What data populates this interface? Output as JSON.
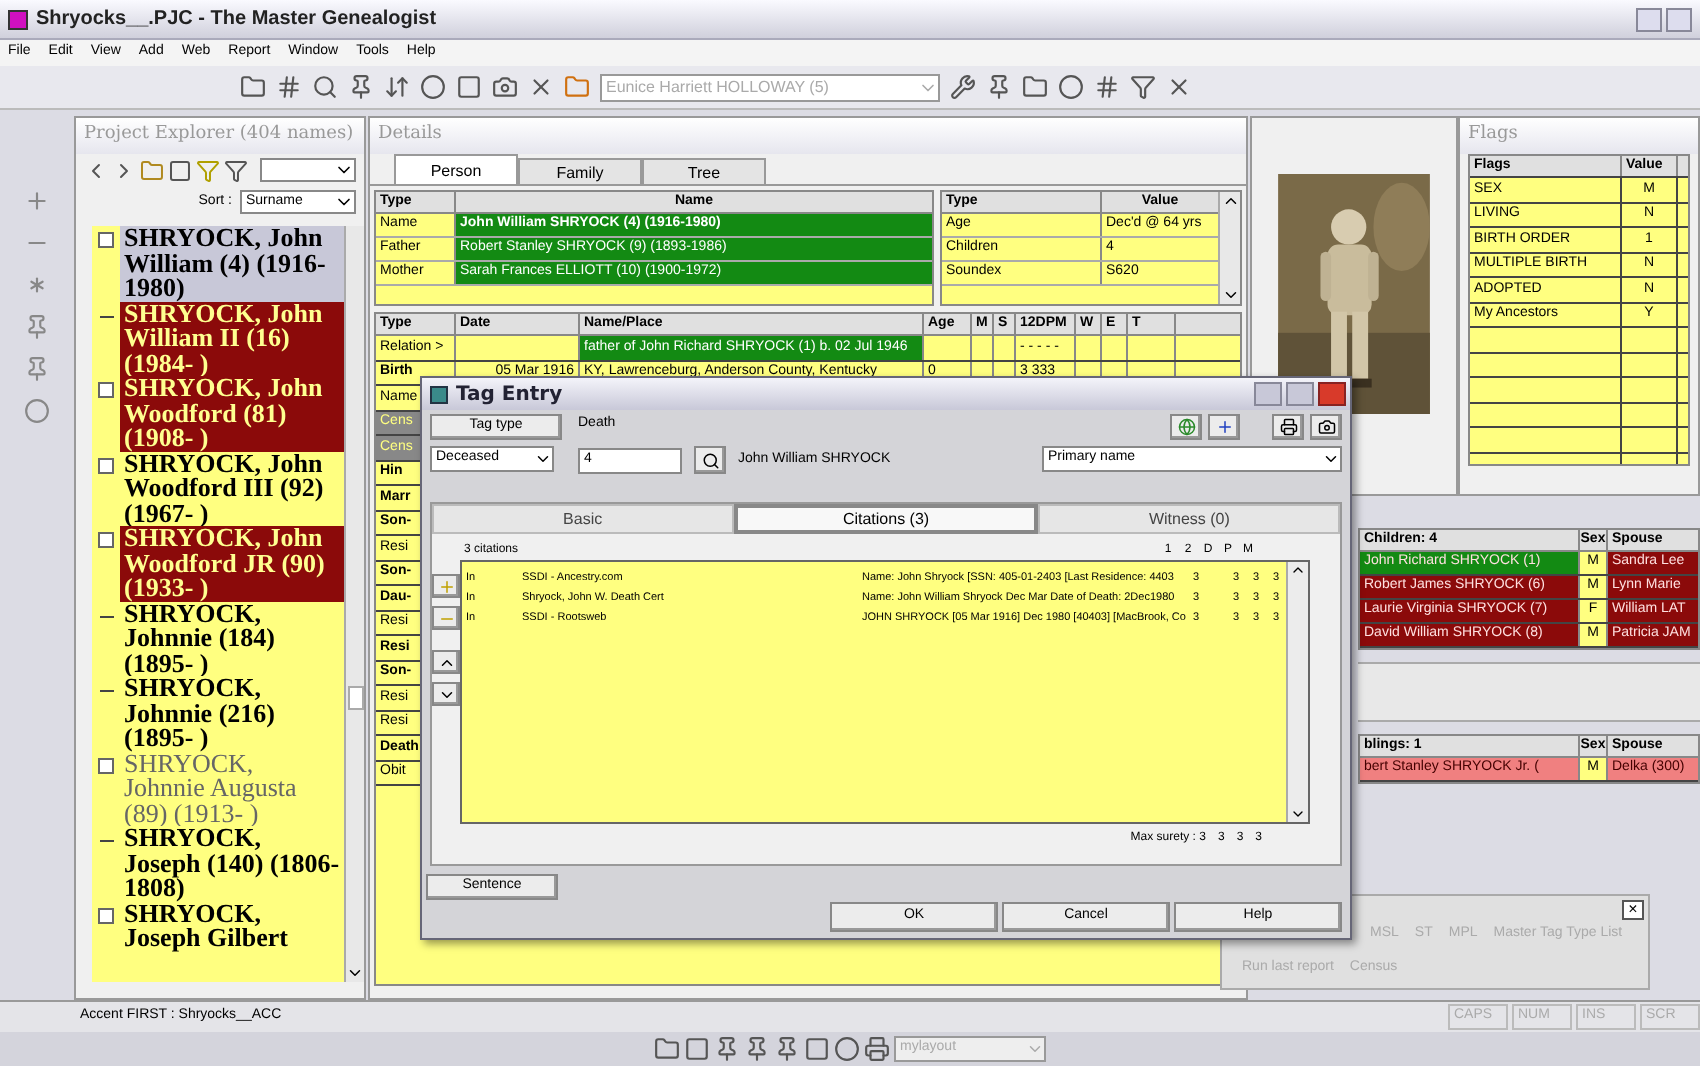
{
  "window": {
    "title": "Shryocks__.PJC - The Master Genealogist"
  },
  "menu": [
    "File",
    "Edit",
    "View",
    "Add",
    "Web",
    "Report",
    "Window",
    "Tools",
    "Help"
  ],
  "toolbar": {
    "person_combo": "Eunice Harriett HOLLOWAY (5)"
  },
  "project_explorer": {
    "title": "Project Explorer (404 names)",
    "sort_label": "Sort :",
    "sort_value": "Surname",
    "items": [
      {
        "text": "SHRYOCK, John William (4) (1916-1980)",
        "color": "#c8c8d8",
        "bold": true,
        "expandable": true
      },
      {
        "text": "SHRYOCK, John William II (16) (1984-  )",
        "color": "#8b0a0a",
        "bold": true,
        "expandable": false
      },
      {
        "text": "SHRYOCK, John Woodford (81) (1908-  )",
        "color": "#8b0a0a",
        "bold": true,
        "expandable": true
      },
      {
        "text": "SHRYOCK, John Woodford III (92) (1967-  )",
        "color": "#ffff80",
        "bold": true,
        "expandable": true
      },
      {
        "text": "SHRYOCK, John Woodford JR (90) (1933-  )",
        "color": "#8b0a0a",
        "bold": true,
        "expandable": true
      },
      {
        "text": "SHRYOCK, Johnnie (184) (1895-  )",
        "color": "#ffff80",
        "bold": true,
        "expandable": false
      },
      {
        "text": "SHRYOCK, Johnnie (216) (1895-  )",
        "color": "#ffff80",
        "bold": true,
        "expandable": false
      },
      {
        "text": "SHRYOCK, Johnnie Augusta (89) (1913-  )",
        "color": "#ffff80",
        "bold": false,
        "expandable": true
      },
      {
        "text": "SHRYOCK, Joseph (140) (1806-1808)",
        "color": "#ffff80",
        "bold": true,
        "expandable": false
      },
      {
        "text": "SHRYOCK, Joseph Gilbert",
        "color": "#ffff80",
        "bold": true,
        "expandable": true
      }
    ]
  },
  "details": {
    "title": "Details",
    "tabs": [
      {
        "label": "Person",
        "selected": true
      },
      {
        "label": "Family",
        "selected": false
      },
      {
        "label": "Tree",
        "selected": false
      }
    ],
    "names_table": {
      "columns": [
        "Type",
        "Name"
      ],
      "rows": [
        {
          "type": "Name",
          "name": "John William SHRYOCK (4)  (1916-1980)",
          "bold": true
        },
        {
          "type": "Father",
          "name": "Robert Stanley SHRYOCK (9)  (1893-1986)",
          "bold": false
        },
        {
          "type": "Mother",
          "name": "Sarah Frances ELLIOTT (10)  (1900-1972)",
          "bold": false
        }
      ]
    },
    "summary_table": {
      "columns": [
        "Type",
        "Value"
      ],
      "rows": [
        {
          "type": "Age",
          "value": "Dec'd @ 64 yrs"
        },
        {
          "type": "Children",
          "value": "4"
        },
        {
          "type": "Soundex",
          "value": "S620"
        }
      ]
    },
    "events_table": {
      "columns": [
        "Type",
        "Date",
        "Name/Place",
        "Age",
        "M",
        "S",
        "12DPM",
        "W",
        "E",
        "T"
      ],
      "rows": [
        {
          "cells": [
            "Relation >",
            null,
            "father of John Richard SHRYOCK (1) b. 02 Jul 1946",
            null,
            null,
            null,
            "- - - - -"
          ],
          "bold": false,
          "highlight": true
        },
        {
          "cells": [
            "Birth",
            "05 Mar 1916",
            "KY, Lawrenceburg, Anderson County, Kentucky",
            "0",
            null,
            null,
            "3  333"
          ],
          "bold": true,
          "highlight": false
        },
        {
          "cells": [
            "Name"
          ],
          "bold": false,
          "grey": false
        },
        {
          "cells": [
            "Cens"
          ],
          "bold": false,
          "grey": true
        },
        {
          "cells": [
            "Cens"
          ],
          "bold": false,
          "grey": true
        },
        {
          "cells": [
            "Hin"
          ],
          "bold": true,
          "grey": false
        },
        {
          "cells": [
            "Marr"
          ],
          "bold": true,
          "grey": false
        },
        {
          "cells": [
            "Son-"
          ],
          "bold": true,
          "grey": false
        },
        {
          "cells": [
            "Resi"
          ],
          "bold": false,
          "grey": false
        },
        {
          "cells": [
            "Son-"
          ],
          "bold": true,
          "grey": false
        },
        {
          "cells": [
            "Dau-"
          ],
          "bold": true,
          "grey": false
        },
        {
          "cells": [
            "Resi"
          ],
          "bold": false,
          "grey": false
        },
        {
          "cells": [
            "Resi"
          ],
          "bold": true,
          "grey": false
        },
        {
          "cells": [
            "Son-"
          ],
          "bold": true,
          "grey": false
        },
        {
          "cells": [
            "Resi"
          ],
          "bold": false,
          "grey": false
        },
        {
          "cells": [
            "Resi"
          ],
          "bold": false,
          "grey": false
        },
        {
          "cells": [
            "Death"
          ],
          "bold": true,
          "grey": false
        },
        {
          "cells": [
            "Obit"
          ],
          "bold": false,
          "grey": false
        }
      ]
    }
  },
  "flags": {
    "title": "Flags",
    "columns": [
      "Flags",
      "Value"
    ],
    "rows": [
      {
        "flag": "SEX",
        "value": "M"
      },
      {
        "flag": "LIVING",
        "value": "N"
      },
      {
        "flag": "BIRTH ORDER",
        "value": "1"
      },
      {
        "flag": "MULTIPLE BIRTH",
        "value": "N"
      },
      {
        "flag": "ADOPTED",
        "value": "N"
      },
      {
        "flag": "My Ancestors",
        "value": "Y"
      }
    ]
  },
  "children": {
    "columns": [
      "Children: 4",
      "Sex",
      "Spouse"
    ],
    "rows": [
      {
        "name": "John Richard SHRYOCK (1)",
        "sex": "M",
        "spouse": "Sandra Lee",
        "color": "#138a13"
      },
      {
        "name": "Robert James SHRYOCK (6)",
        "sex": "M",
        "spouse": "Lynn Marie",
        "color": "#8b0a0a"
      },
      {
        "name": "Laurie Virginia SHRYOCK (7)",
        "sex": "F",
        "spouse": "William LAT",
        "color": "#8b0a0a"
      },
      {
        "name": "David William SHRYOCK (8)",
        "sex": "M",
        "spouse": "Patricia JAM",
        "color": "#8b0a0a"
      }
    ]
  },
  "siblings": {
    "columns": [
      "blings: 1",
      "Sex",
      "Spouse"
    ],
    "rows": [
      {
        "name": "bert Stanley SHRYOCK Jr. (",
        "sex": "M",
        "spouse": "Delka (300)"
      }
    ]
  },
  "reports_panel": {
    "close": "×",
    "links": [
      "MSL",
      "ST",
      "MPL",
      "Master Tag Type List",
      "Run last report",
      "Census"
    ]
  },
  "tag_entry": {
    "title": "Tag Entry",
    "tag_type_button": "Tag type",
    "tag_name": "Death",
    "tag_select": "Deceased",
    "id_field": "4",
    "person": "John William SHRYOCK",
    "name_select": "Primary name",
    "tabs": [
      {
        "label": "Basic",
        "selected": false
      },
      {
        "label": "Citations (3)",
        "selected": true
      },
      {
        "label": "Witness (0)",
        "selected": false
      }
    ],
    "citations_count": "3  citations",
    "surety_headers": [
      "1",
      "2",
      "D",
      "P",
      "M"
    ],
    "citations": [
      {
        "marker": "In",
        "source": "SSDI - Ancestry.com",
        "detail": "Name: John Shryock [SSN: 405-01-2403 [Last Residence: 4403",
        "surety_1": "3",
        "surety_dpm": [
          "3",
          "3",
          "3"
        ]
      },
      {
        "marker": "In",
        "source": "Shryock, John W. Death Cert",
        "detail": "Name: John William Shryock Dec Mar Date of Death: 2Dec1980",
        "surety_1": "3",
        "surety_dpm": [
          "3",
          "3",
          "3"
        ]
      },
      {
        "marker": "In",
        "source": "SSDI - Rootsweb",
        "detail": "JOHN SHRYOCK [05 Mar 1916] Dec 1980 [40403] [MacBrook, Co",
        "surety_1": "3",
        "surety_dpm": [
          "3",
          "3",
          "3"
        ]
      }
    ],
    "max_surety": "Max surety : 3",
    "max_values": [
      "3",
      "3",
      "3"
    ],
    "buttons": {
      "sentence": "Sentence",
      "ok": "OK",
      "cancel": "Cancel",
      "help": "Help"
    }
  },
  "status_bar": {
    "text": "Accent FIRST : Shryocks__ACC",
    "indicators": [
      "CAPS",
      "NUM",
      "INS",
      "SCR"
    ]
  },
  "taskbar": {
    "layout_combo": "mylayout"
  }
}
